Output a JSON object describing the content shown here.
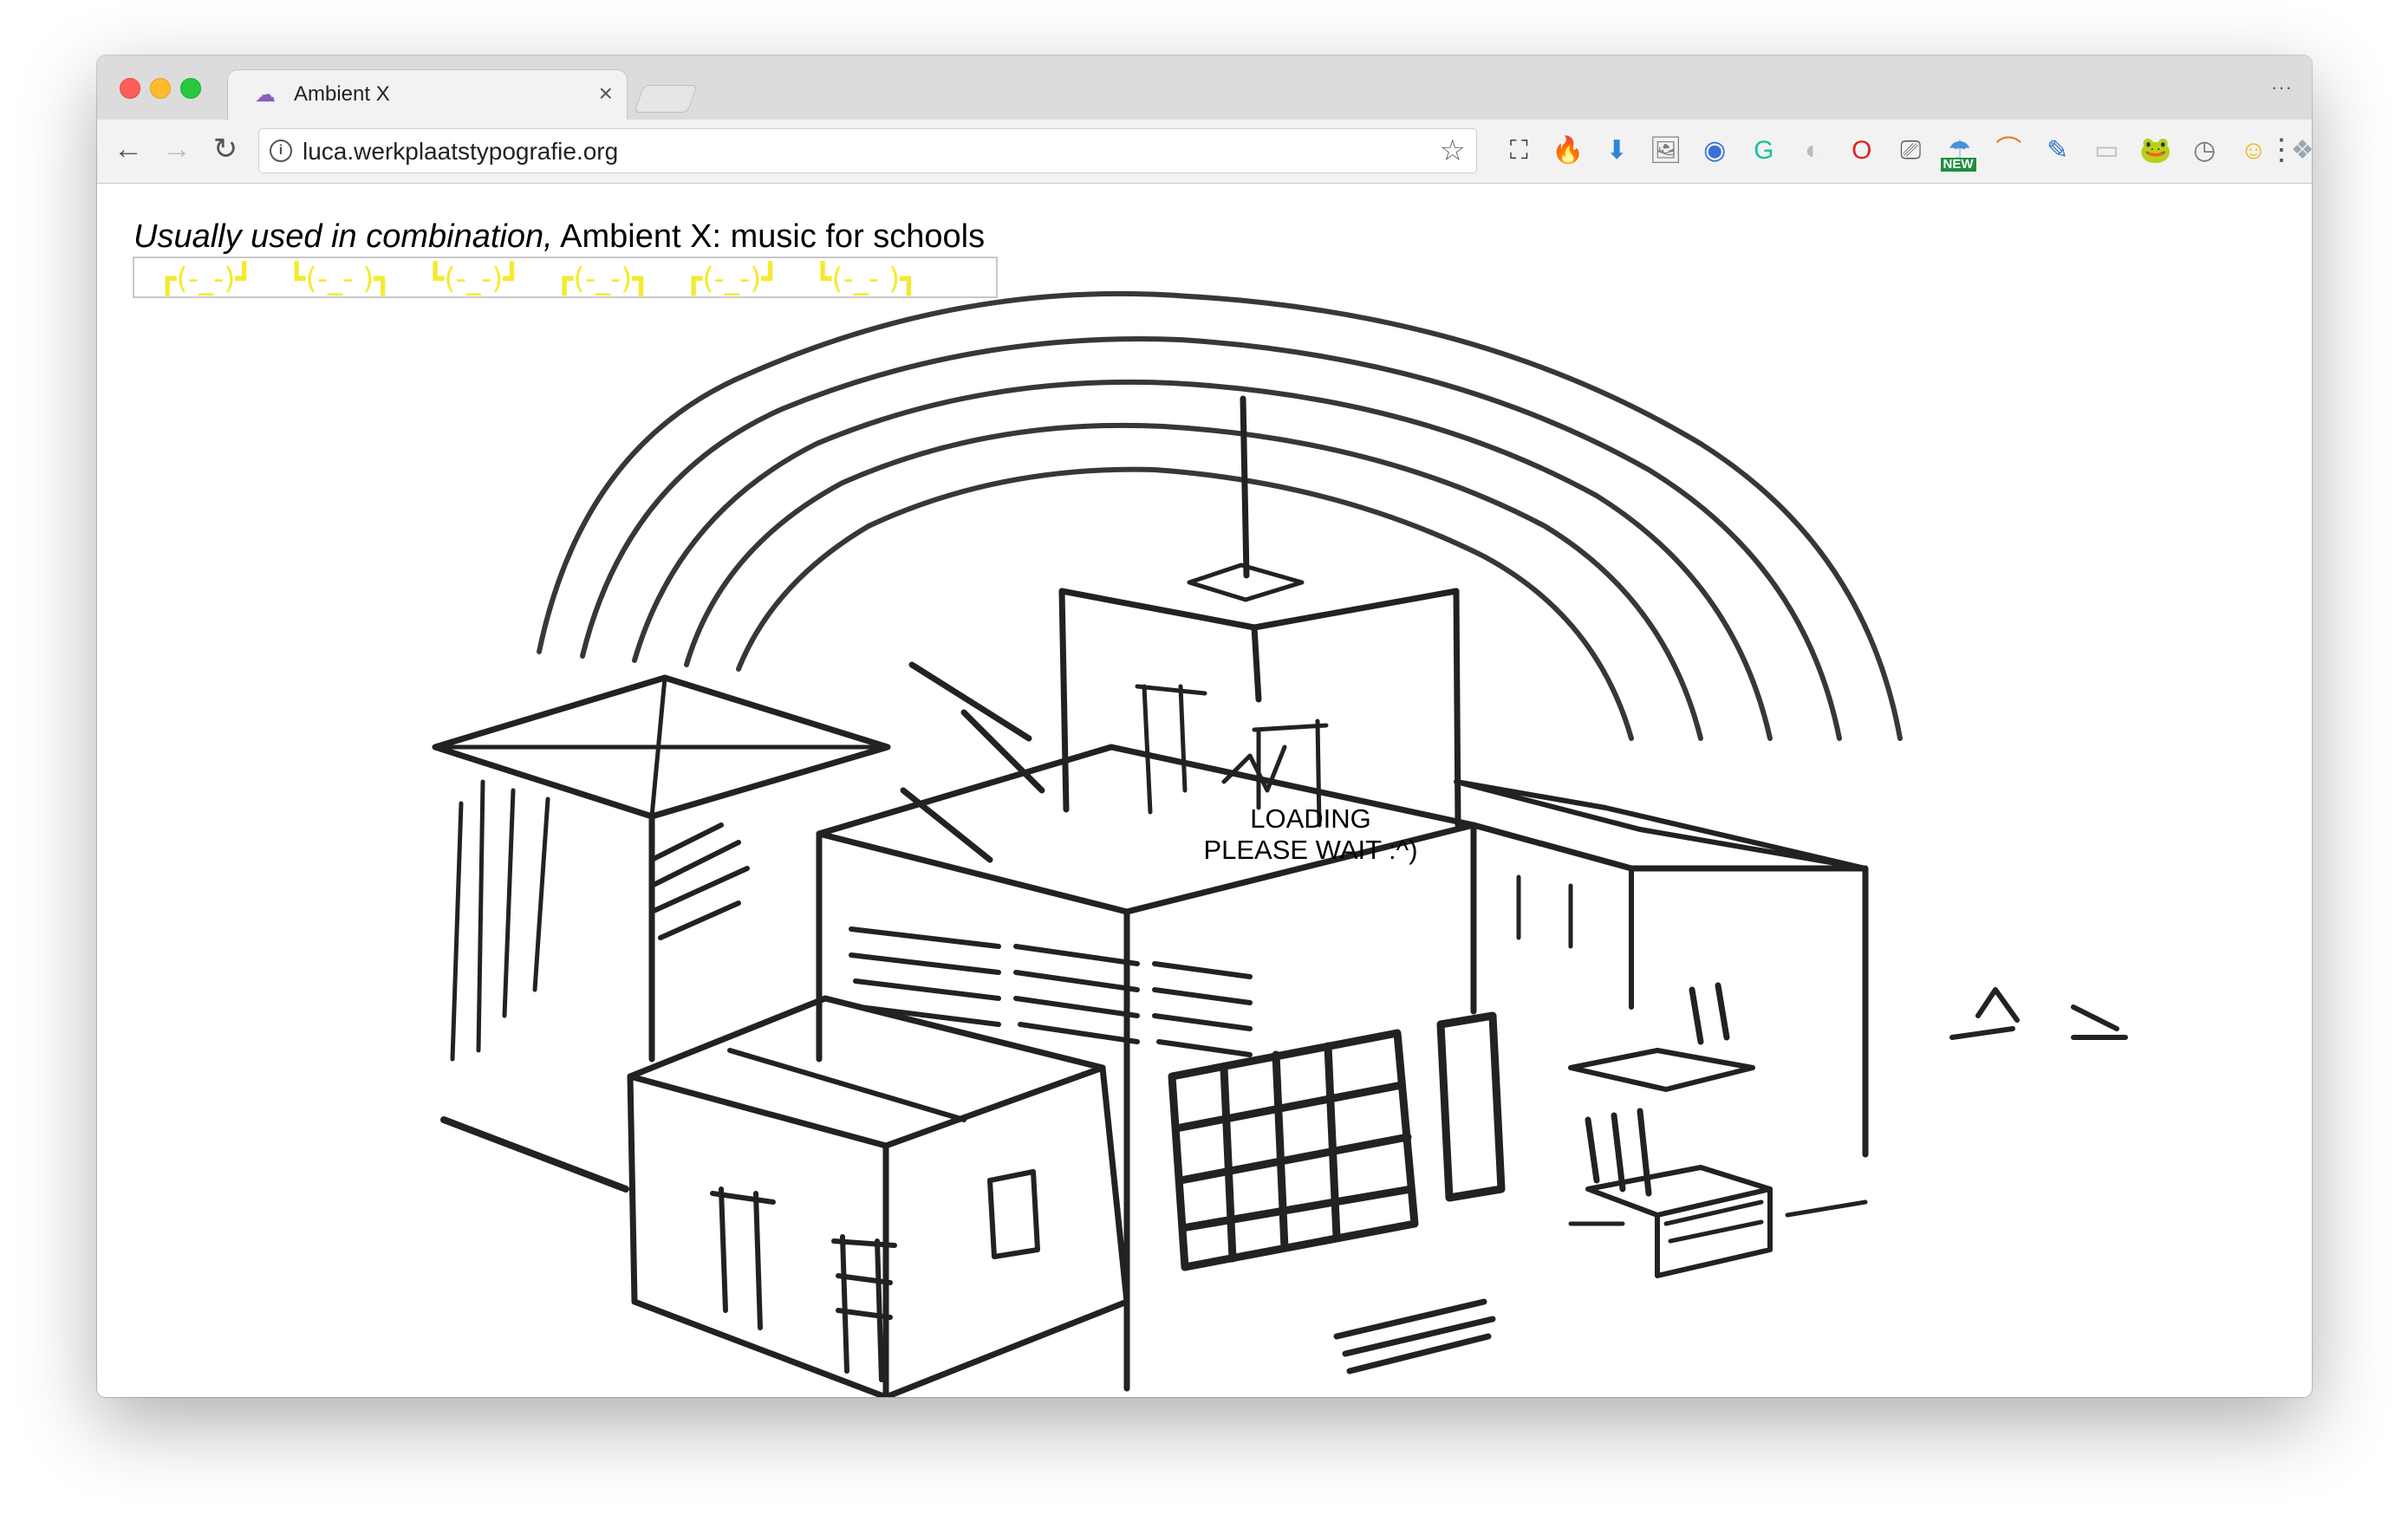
{
  "browser": {
    "tab_title": "Ambient X",
    "tab_favicon": "cloud-icon",
    "url": "luca.werkplaatstypografie.org",
    "window_menu_label": "···",
    "extensions": [
      "screenshot-icon",
      "flame-icon",
      "download-icon",
      "image-icon",
      "shield-icon",
      "grammarly-icon",
      "sync-icon",
      "opera-icon",
      "cast-icon",
      "new-extension-icon",
      "rainbow-icon",
      "eyedropper-icon",
      "chat-icon",
      "frog-icon",
      "history-icon",
      "emoji-icon",
      "dropbox-icon"
    ],
    "extension_glyphs": [
      "⛶",
      "🔥",
      "⬇",
      "🖼",
      "◉",
      "G",
      "◐",
      "O",
      "⎚",
      "☂",
      "⌒",
      "✎",
      "▭",
      "🐸",
      "◷",
      "☺",
      "❖"
    ],
    "new_badge": "NEW"
  },
  "page": {
    "title_italic": "Usually used in combination,",
    "title_plain": " Ambient X: music for schools",
    "kaomoji": [
      "┏(-_-)┛",
      "┗(-_- )┓",
      "┗(-_-)┛",
      "┏(-_-)┓",
      "┏(-_-)┛",
      "┗(-_- )┓"
    ],
    "loading_line1": "LOADING",
    "loading_line2": "PLEASE WAIT :^)"
  },
  "colors": {
    "kaomoji": "#f5ea2e",
    "tabstrip": "#dcdcdc",
    "toolbar": "#f2f2f2"
  }
}
